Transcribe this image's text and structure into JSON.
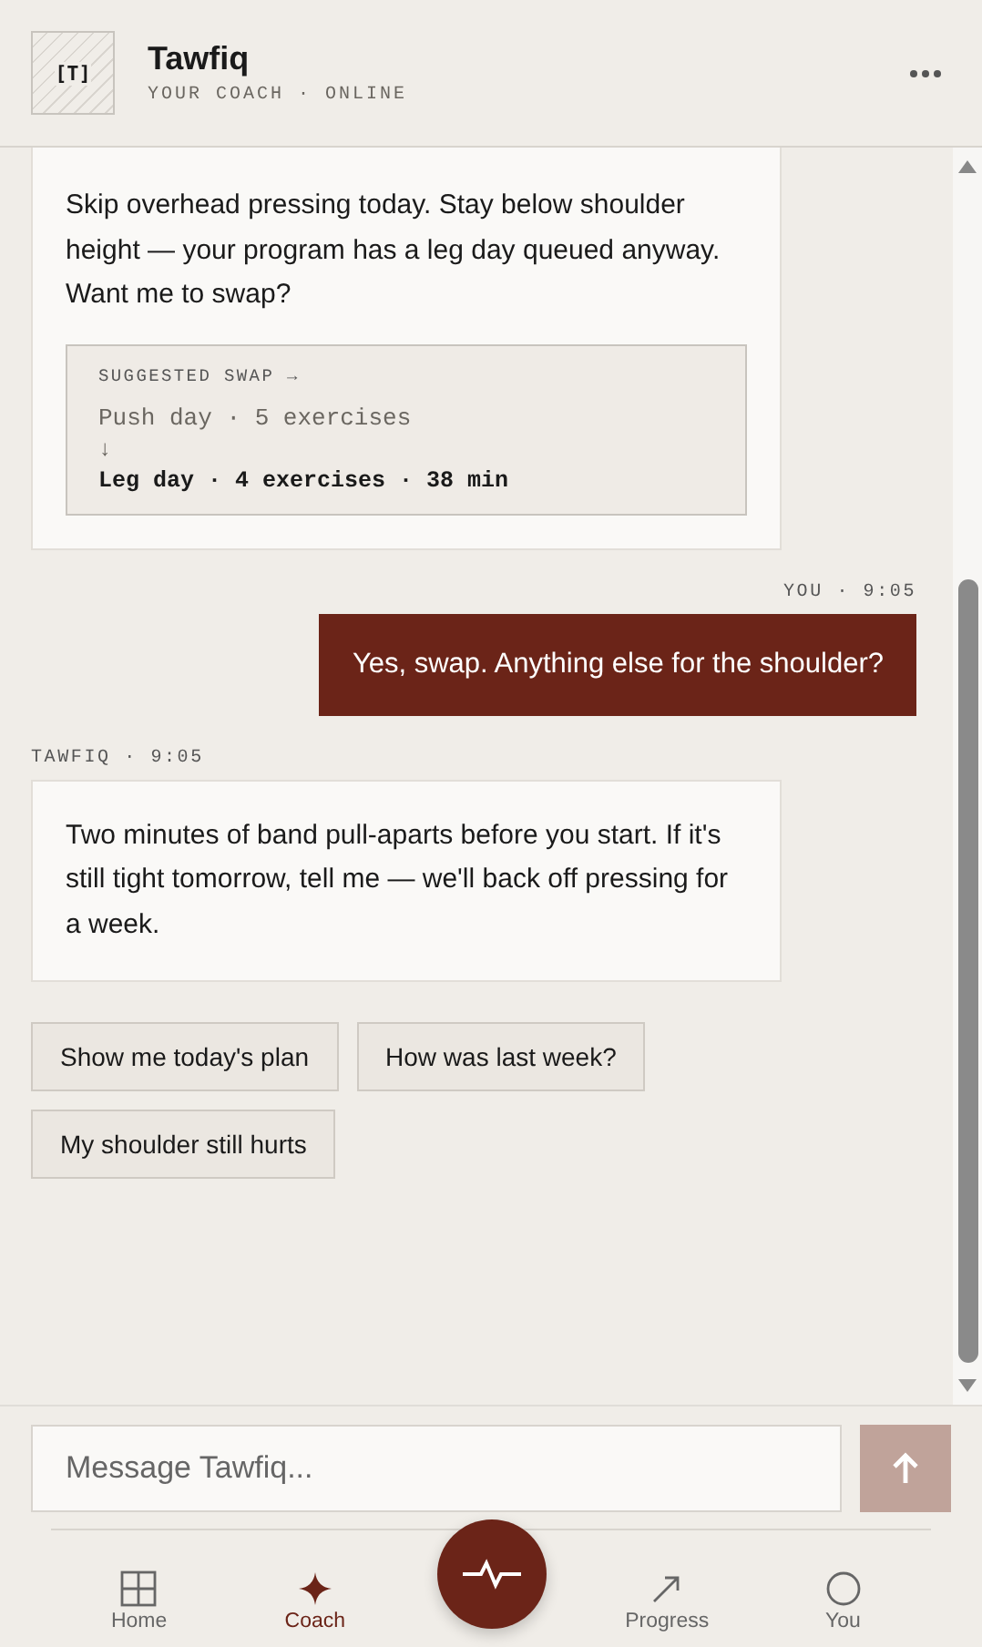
{
  "header": {
    "avatar": "[T]",
    "name": "Tawfiq",
    "status": "YOUR COACH · ONLINE"
  },
  "messages": [
    {
      "kind": "coach",
      "text": "Skip overhead pressing today. Stay below shoulder height — your program has a leg day queued anyway. Want me to swap?",
      "swap": {
        "label": "SUGGESTED SWAP →",
        "from": "Push day · 5 exercises",
        "arrow": "↓",
        "to": "Leg day · 4 exercises · 38 min"
      }
    },
    {
      "kind": "user",
      "meta": "YOU · 9:05",
      "text": "Yes, swap. Anything else for the shoulder?"
    },
    {
      "kind": "coach",
      "meta": "TAWFIQ · 9:05",
      "text": "Two minutes of band pull-aparts before you start. If it's still tight tomorrow, tell me — we'll back off pressing for a week."
    }
  ],
  "suggestions": [
    "Show me today's plan",
    "How was last week?",
    "My shoulder still hurts"
  ],
  "composer": {
    "placeholder": "Message Tawfiq...",
    "send_disabled": true
  },
  "nav": [
    {
      "kind": "grid",
      "label": "Home",
      "selected": false
    },
    {
      "kind": "star",
      "label": "Coach",
      "selected": true
    },
    {
      "kind": "arrow",
      "label": "Progress",
      "selected": false
    },
    {
      "kind": "circle",
      "label": "You",
      "selected": false
    }
  ]
}
